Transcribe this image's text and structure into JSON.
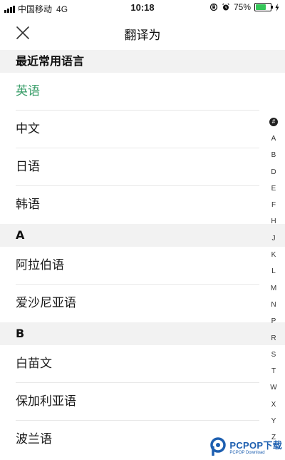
{
  "status_bar": {
    "carrier": "中国移动",
    "network": "4G",
    "time": "10:18",
    "battery_percent_text": "75%",
    "battery_level": 0.75,
    "icons": [
      "signal-icon",
      "rotation-lock-icon",
      "alarm-icon",
      "battery-icon",
      "charging-icon"
    ]
  },
  "header": {
    "title": "翻译为",
    "close_icon": "close-icon"
  },
  "sections": [
    {
      "title": "最近常用语言",
      "items": [
        "英语",
        "中文",
        "日语",
        "韩语"
      ],
      "active_index": 0
    },
    {
      "title": "A",
      "items": [
        "阿拉伯语",
        "爱沙尼亚语"
      ]
    },
    {
      "title": "B",
      "items": [
        "白苗文",
        "保加利亚语",
        "波兰语"
      ]
    }
  ],
  "index_bar": [
    "#",
    "A",
    "B",
    "D",
    "E",
    "F",
    "H",
    "J",
    "K",
    "L",
    "M",
    "N",
    "P",
    "R",
    "S",
    "T",
    "W",
    "X",
    "Y",
    "Z"
  ],
  "watermark": {
    "main": "PCPOP下载",
    "sub": "PCPOP Download"
  },
  "colors": {
    "accent": "#3a9e6a",
    "section_bg": "#f2f2f2",
    "battery": "#35c759",
    "watermark": "#1d5fb0"
  }
}
